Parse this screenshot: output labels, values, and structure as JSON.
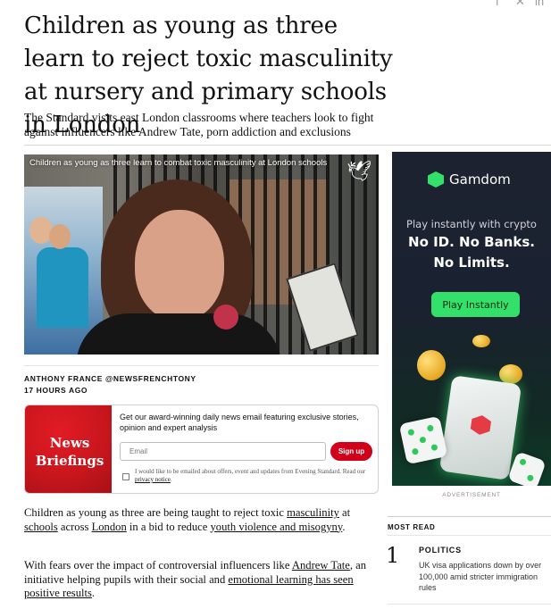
{
  "article": {
    "headline": "Children as young as three learn to reject toxic masculinity at nursery and primary schools in London",
    "standfirst": "The Standard visits east London classrooms where teachers look to fight against influencers like Andrew Tate, porn addiction and exclusions",
    "video": {
      "caption": "Children as young as three learn to combat toxic masculinity at London schools",
      "logo_icon": "standard-bird-icon"
    },
    "byline": {
      "author": "ANTHONY FRANCE @NEWSFRENCHTONY",
      "time": "17 HOURS AGO"
    },
    "body": {
      "p1": {
        "t1": "Children as young as three are being taught to reject toxic ",
        "l1": "masculinity",
        "t2": " at ",
        "l2": "schools",
        "t3": " across ",
        "l3": "London",
        "t4": " in a bid to reduce ",
        "l4": "youth violence and misogyny",
        "t5": "."
      },
      "p2": {
        "t1": "With fears over the impact of controversial influencers like ",
        "l1": "Andrew Tate",
        "t2": ", an initiative helping pupils with their social and ",
        "l2": "emotional learning has seen positive results",
        "t3": "."
      }
    }
  },
  "newsletter": {
    "image_text": "News Briefings",
    "promo": "Get our award-winning daily news email featuring exclusive stories, opinion and expert analysis",
    "email_placeholder": "Email",
    "signup_label": "Sign up",
    "consent_text": "I would like to be emailed about offers, event and updates from Evening Standard. Read our ",
    "privacy_link": "privacy notice",
    "consent_end": ".",
    "accent_color": "#d0021b"
  },
  "ad": {
    "brand": "Gamdom",
    "tagline": "Play instantly with crypto",
    "headline1": "No ID. No Banks.",
    "headline2": "No Limits.",
    "cta": "Play Instantly",
    "label": "ADVERTISEMENT",
    "accent_color": "#33e06a"
  },
  "most_read": {
    "title": "MOST READ",
    "items": [
      {
        "rank": "1",
        "category": "POLITICS",
        "headline": "UK visa applications down by over 100,000 amid stricter immigration rules"
      }
    ]
  },
  "share_icons": [
    "facebook-icon",
    "x-icon",
    "linkedin-icon"
  ]
}
